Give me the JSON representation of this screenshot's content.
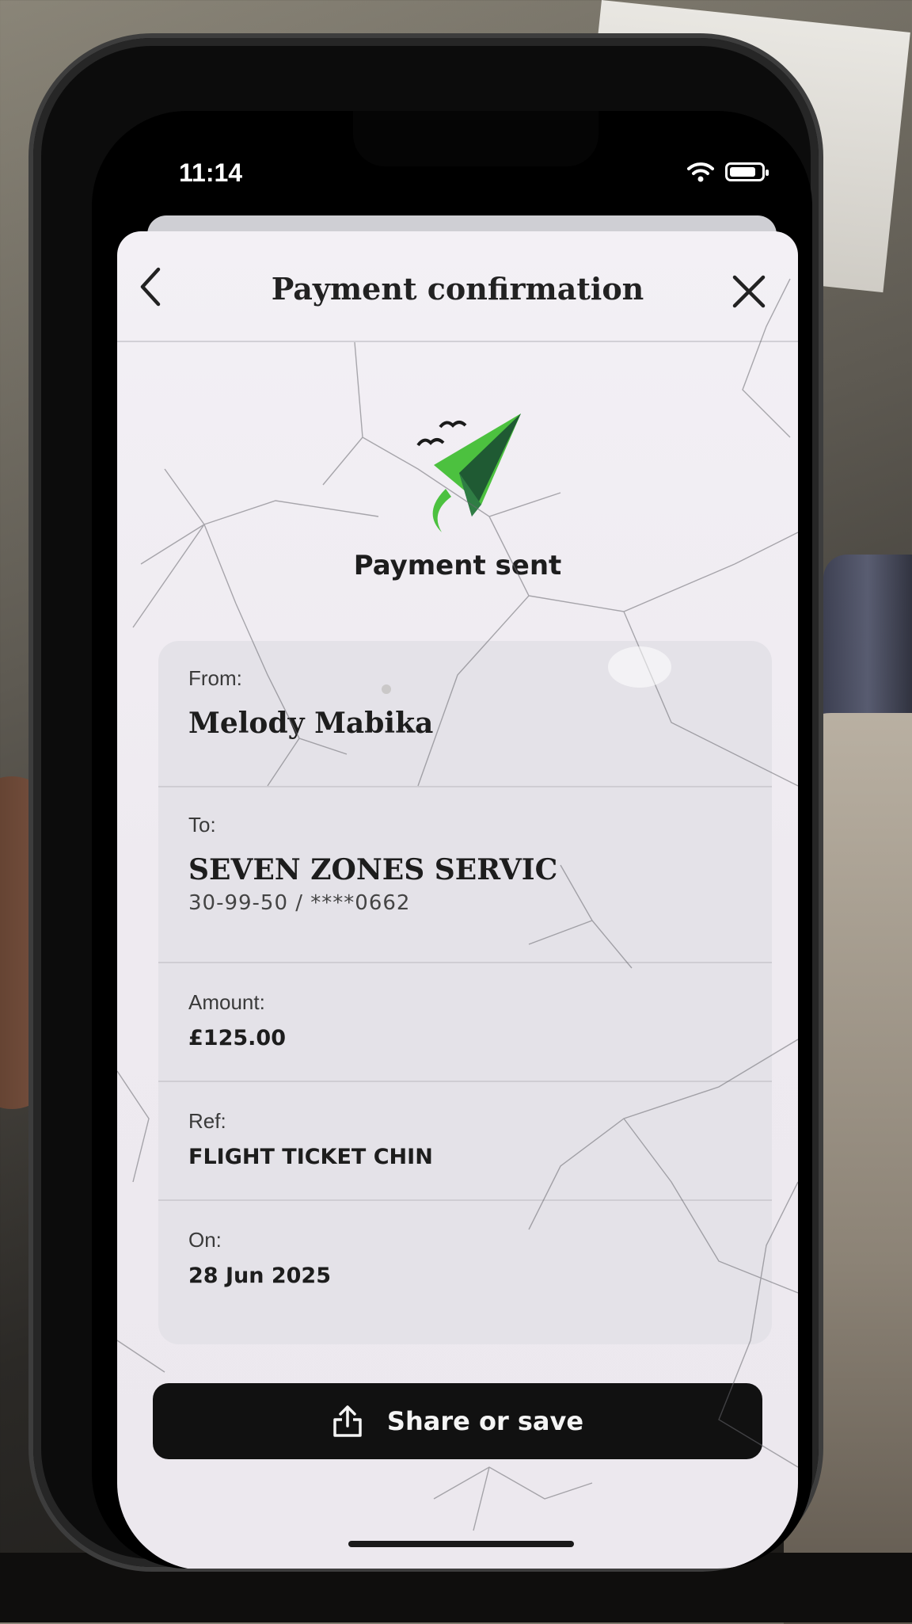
{
  "status_bar": {
    "time": "11:14",
    "wifi_icon": "wifi-icon",
    "battery_icon": "battery-icon",
    "battery_level": 0.85
  },
  "header": {
    "title": "Payment confirmation",
    "back_icon": "chevron-left-icon",
    "close_icon": "close-icon"
  },
  "hero": {
    "icon": "paper-plane-icon",
    "title": "Payment sent",
    "accent_color": "#4cc13f",
    "dark_color": "#1f5a33"
  },
  "details": {
    "from_label": "From:",
    "from_value": "Melody Mabika",
    "to_label": "To:",
    "to_value": "SEVEN ZONES SERVIC",
    "to_account": "30-99-50 / ****0662",
    "amount_label": "Amount:",
    "amount_value": "£125.00",
    "ref_label": "Ref:",
    "ref_value": "FLIGHT TICKET CHIN",
    "on_label": "On:",
    "on_value": "28 Jun 2025"
  },
  "actions": {
    "share_label": "Share or save",
    "share_icon": "share-icon"
  }
}
